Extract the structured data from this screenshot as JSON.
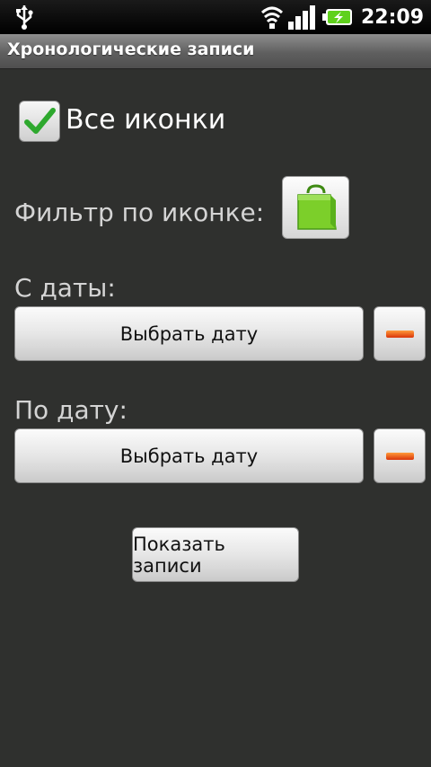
{
  "status_bar": {
    "time": "22:09",
    "icons": [
      "usb-icon",
      "wifi-icon",
      "signal-icon",
      "battery-charging-icon"
    ]
  },
  "app": {
    "title": "Хронологические записи"
  },
  "filters": {
    "all_icons_label": "Все иконки",
    "all_icons_checked": true,
    "icon_filter_label": "Фильтр по иконке:",
    "icon_filter_icon": "green-bag-icon"
  },
  "from_date": {
    "label": "С даты:",
    "button_label": "Выбрать дату"
  },
  "to_date": {
    "label": "По дату:",
    "button_label": "Выбрать дату"
  },
  "actions": {
    "show_records_label": "Показать записи"
  },
  "colors": {
    "background": "#2f302e",
    "check_green": "#2ea82e",
    "bag_green": "#7ccf2a",
    "minus_orange": "#e5531a"
  }
}
